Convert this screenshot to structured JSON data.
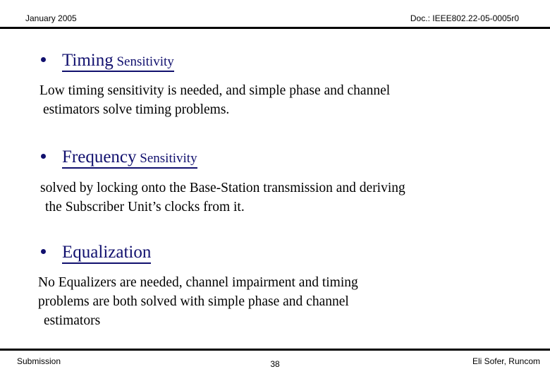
{
  "header": {
    "date": "January 2005",
    "doc": "Doc.: IEEE802.22-05-0005r0"
  },
  "colors": {
    "heading": "#11106e",
    "body": "#000000",
    "rule": "#000000",
    "background": "#ffffff"
  },
  "slide": {
    "blocks": [
      {
        "heading_main": "Timing",
        "heading_sub": " Sensitivity",
        "lines": [
          "Low timing sensitivity is needed, and simple phase and channel",
          "estimators solve timing problems."
        ]
      },
      {
        "heading_main": "Frequency",
        "heading_sub": " Sensitivity",
        "lines": [
          "solved by locking onto the Base-Station transmission and deriving",
          "the Subscriber Unit’s clocks from it."
        ]
      },
      {
        "heading_main": "Equalization",
        "heading_sub": "",
        "lines": [
          "No Equalizers are needed, channel impairment and timing",
          "problems are both solved with simple phase and channel",
          "estimators"
        ]
      }
    ]
  },
  "footer": {
    "left": "Submission",
    "page": "38",
    "right": "Eli Sofer, Runcom"
  }
}
